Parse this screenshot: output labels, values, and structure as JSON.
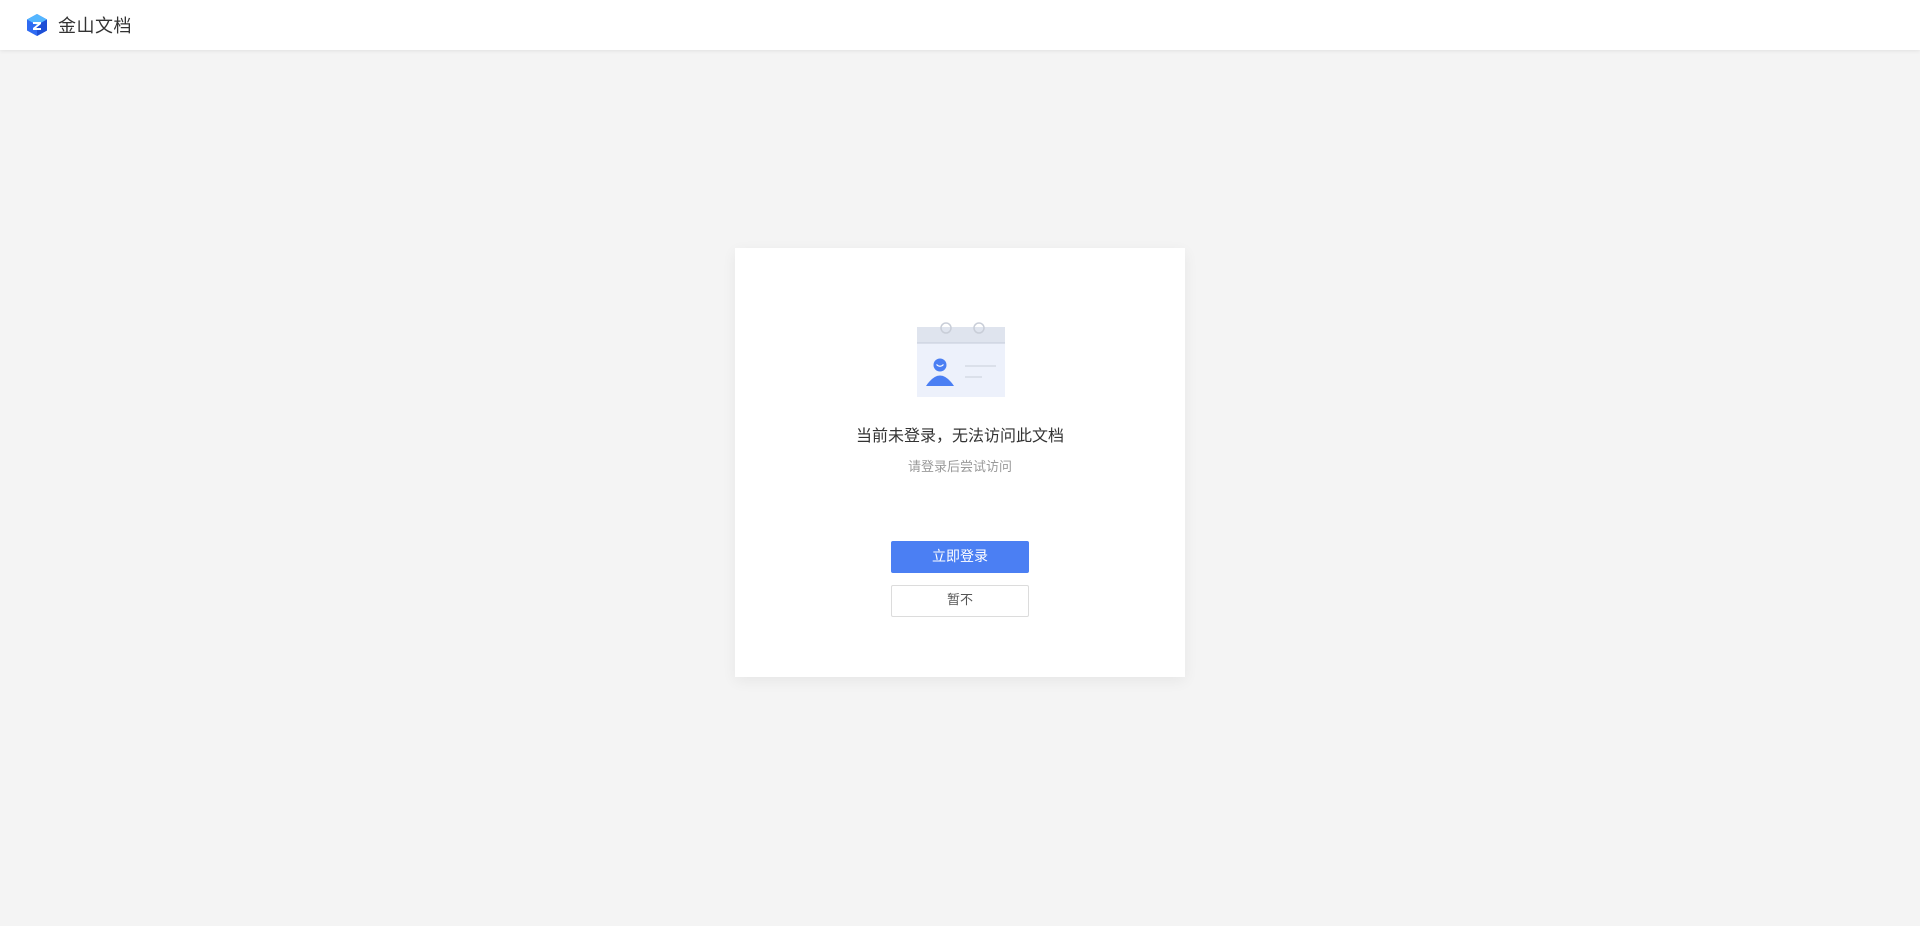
{
  "header": {
    "app_name": "金山文档",
    "logo_icon": "kingsoft-docs-logo-icon"
  },
  "dialog": {
    "illustration_icon": "user-calendar-card-icon",
    "title": "当前未登录，无法访问此文档",
    "subtitle": "请登录后尝试访问",
    "login_button_label": "立即登录",
    "skip_button_label": "暂不"
  },
  "colors": {
    "background": "#f4f4f4",
    "primary": "#4b7ff3",
    "title_text": "#333333",
    "subtitle_text": "#9a9a9a"
  }
}
